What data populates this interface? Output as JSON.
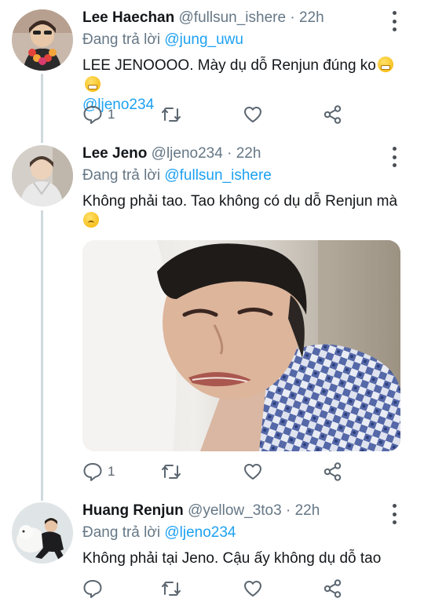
{
  "tweets": [
    {
      "name": "Lee Haechan",
      "handle": "@fullsun_ishere",
      "time": "22h",
      "reply_prefix": "Đang trả lời",
      "reply_to": "@jung_uwu",
      "text": "LEE JENOOOO. Mày dụ dỗ Renjun đúng ko",
      "text_mention": "@ljeno234",
      "reply_count": "1",
      "emoji": [
        "grimacing-face-emoji",
        "grimacing-face-emoji"
      ]
    },
    {
      "name": "Lee Jeno",
      "handle": "@ljeno234",
      "time": "22h",
      "reply_prefix": "Đang trả lời",
      "reply_to": "@fullsun_ishere",
      "text": "Không phải tao. Tao không có dụ dỗ Renjun mà",
      "reply_count": "1",
      "emoji": [
        "sad-face-emoji"
      ],
      "has_image": true
    },
    {
      "name": "Huang Renjun",
      "handle": "@yellow_3to3",
      "time": "22h",
      "reply_prefix": "Đang trả lời",
      "reply_to": "@ljeno234",
      "text": "Không phải tại Jeno. Cậu ấy không dụ dỗ tao"
    }
  ],
  "separator": "·",
  "icons": {
    "reply": "speech-bubble-icon",
    "retweet": "retweet-icon",
    "like": "heart-icon",
    "share": "share-icon",
    "more": "kebab-menu-icon"
  },
  "colors": {
    "mention": "#1da1f2",
    "secondary_text": "#657786",
    "thread_line": "#cfd9de"
  }
}
